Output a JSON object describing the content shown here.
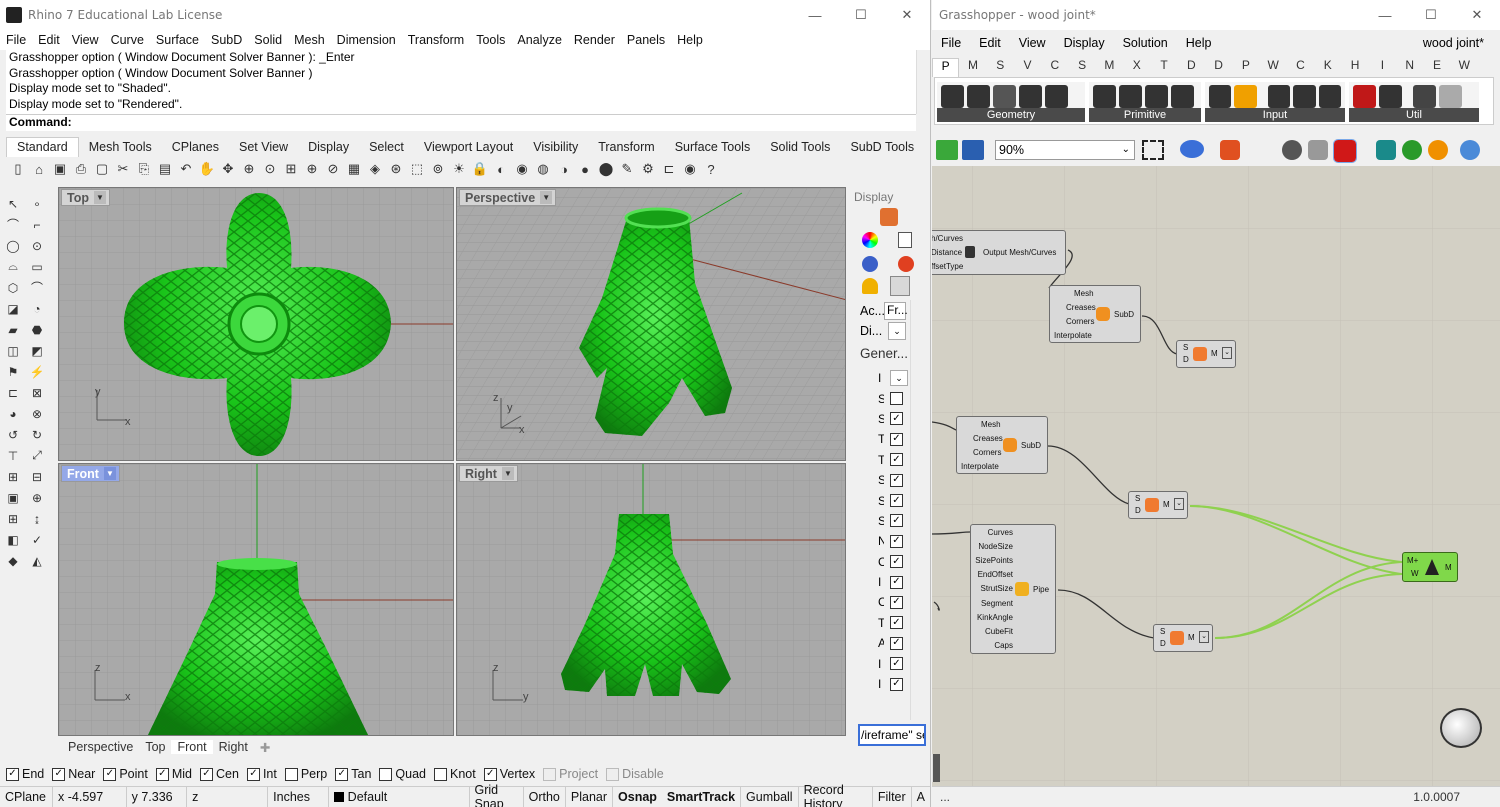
{
  "rhino": {
    "title": "Rhino 7 Educational Lab License",
    "menu": [
      "File",
      "Edit",
      "View",
      "Curve",
      "Surface",
      "SubD",
      "Solid",
      "Mesh",
      "Dimension",
      "Transform",
      "Tools",
      "Analyze",
      "Render",
      "Panels",
      "Help"
    ],
    "history": [
      "Grasshopper option ( Window  Document  Solver  Banner ): _Enter",
      "Grasshopper option ( Window  Document  Solver  Banner )",
      "Display mode set to \"Shaded\".",
      "Display mode set to \"Rendered\"."
    ],
    "command_label": "Command:",
    "tabs": [
      "Standard",
      "Mesh Tools",
      "CPlanes",
      "Set View",
      "Display",
      "Select",
      "Viewport Layout",
      "Visibility",
      "Transform",
      "Surface Tools",
      "Solid Tools",
      "SubD Tools"
    ],
    "viewports": {
      "top": "Top",
      "perspective": "Perspective",
      "front": "Front",
      "right": "Right"
    },
    "axes": {
      "x": "x",
      "y": "y",
      "z": "z"
    },
    "viewport_tabs": [
      "Perspective",
      "Top",
      "Front",
      "Right"
    ],
    "display_panel": {
      "title": "Display",
      "row1": "Ac...",
      "row1b": "Fr...",
      "row2": "Di...",
      "section": "Gener...",
      "letters": [
        "I",
        "S",
        "S",
        "T",
        "T",
        "S",
        "S",
        "S",
        "N",
        "C",
        "I",
        "C",
        "T",
        "A",
        "I",
        "I"
      ],
      "checked": [
        false,
        false,
        true,
        true,
        true,
        true,
        true,
        true,
        true,
        true,
        true,
        true,
        true,
        true,
        true,
        true
      ],
      "bottom_text": "/ireframe\" se"
    },
    "osnaps": [
      {
        "label": "End",
        "checked": true,
        "enabled": true
      },
      {
        "label": "Near",
        "checked": true,
        "enabled": true
      },
      {
        "label": "Point",
        "checked": true,
        "enabled": true
      },
      {
        "label": "Mid",
        "checked": true,
        "enabled": true
      },
      {
        "label": "Cen",
        "checked": true,
        "enabled": true
      },
      {
        "label": "Int",
        "checked": true,
        "enabled": true
      },
      {
        "label": "Perp",
        "checked": false,
        "enabled": true
      },
      {
        "label": "Tan",
        "checked": true,
        "enabled": true
      },
      {
        "label": "Quad",
        "checked": false,
        "enabled": true
      },
      {
        "label": "Knot",
        "checked": false,
        "enabled": true
      },
      {
        "label": "Vertex",
        "checked": true,
        "enabled": true
      },
      {
        "label": "Project",
        "checked": false,
        "enabled": false
      },
      {
        "label": "Disable",
        "checked": false,
        "enabled": false
      }
    ],
    "status": {
      "cplane": "CPlane",
      "x": "x -4.597",
      "y": "y 7.336",
      "z": "z",
      "units": "Inches",
      "layer": "Default",
      "toggles": [
        "Grid Snap",
        "Ortho",
        "Planar",
        "Osnap",
        "SmartTrack",
        "Gumball",
        "Record History",
        "Filter",
        "A"
      ]
    }
  },
  "gh": {
    "title": "Grasshopper - wood joint*",
    "menu": [
      "File",
      "Edit",
      "View",
      "Display",
      "Solution",
      "Help"
    ],
    "doc_name": "wood joint*",
    "tabs": [
      "P",
      "M",
      "S",
      "V",
      "C",
      "S",
      "M",
      "X",
      "T",
      "D",
      "D",
      "P",
      "W",
      "C",
      "K",
      "H",
      "I",
      "N",
      "E",
      "W"
    ],
    "groups": [
      "Geometry",
      "Primitive",
      "Input",
      "Util"
    ],
    "zoom": "90%",
    "components": {
      "offset": {
        "in": [
          "h/Curves",
          "Distance",
          "ffsetType"
        ],
        "out": "Output Mesh/Curves"
      },
      "subd1": {
        "in": [
          "Mesh",
          "Creases",
          "Corners",
          "Interpolate"
        ],
        "out": "SubD"
      },
      "subd2": {
        "in": [
          "Mesh",
          "Creases",
          "Corners",
          "Interpolate"
        ],
        "out": "SubD"
      },
      "pipe": {
        "in": [
          "Curves",
          "NodeSize",
          "SizePoints",
          "EndOffset",
          "StrutSize",
          "Segment",
          "KinkAngle",
          "CubeFit",
          "Caps"
        ],
        "out": "Pipe"
      },
      "conv_in": [
        "S",
        "D"
      ],
      "conv_out": "M",
      "merge_in": [
        "M+",
        "W"
      ],
      "merge_out": "M"
    },
    "version": "1.0.0007",
    "status_left": "..."
  },
  "colors": {
    "model_green": "#19c419",
    "viewport_bg": "#a9a9a9",
    "canvas": "#d3d0c5",
    "active_view": "#94a8e8",
    "wire_green": "#8fd14f"
  }
}
